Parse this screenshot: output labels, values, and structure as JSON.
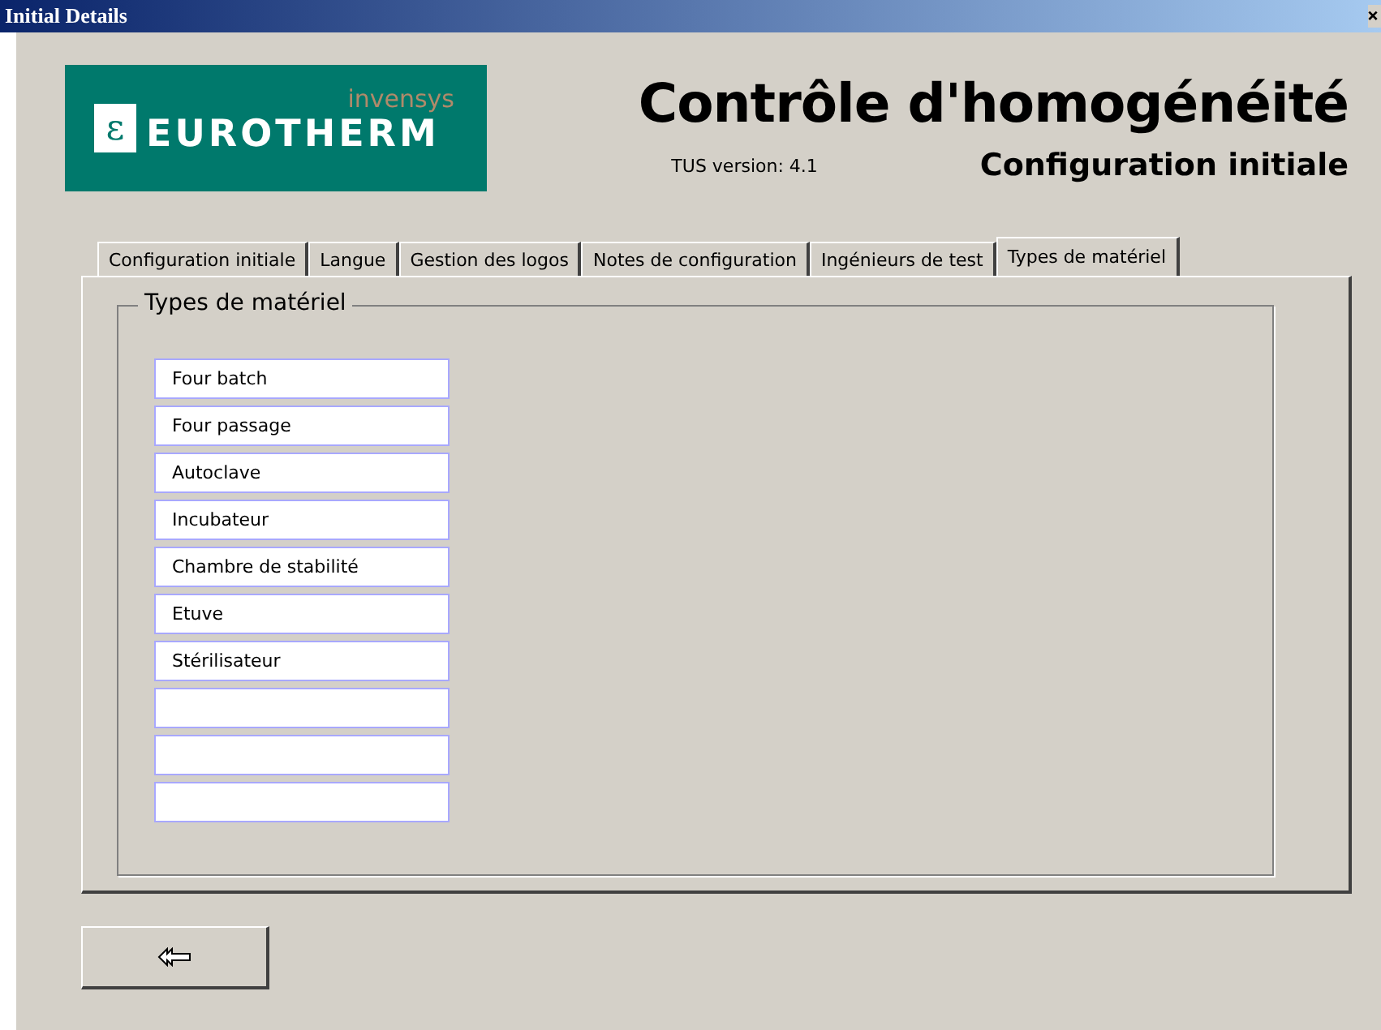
{
  "window": {
    "title": "Initial Details"
  },
  "logo": {
    "mark": "ε",
    "brand": "invensys",
    "name": "EUROTHERM"
  },
  "header": {
    "title": "Contrôle d'homogénéité",
    "version": "TUS version: 4.1",
    "subtitle": "Configuration initiale"
  },
  "tabs": [
    {
      "label": "Configuration initiale",
      "selected": false
    },
    {
      "label": "Langue",
      "selected": false
    },
    {
      "label": "Gestion des logos",
      "selected": false
    },
    {
      "label": "Notes de configuration",
      "selected": false
    },
    {
      "label": "Ingénieurs de test",
      "selected": false
    },
    {
      "label": "Types de matériel",
      "selected": true
    }
  ],
  "group": {
    "title": "Types de matériel",
    "fields": [
      {
        "kind": "filled",
        "value": "Four batch"
      },
      {
        "kind": "filled",
        "value": "Four passage"
      },
      {
        "kind": "filled",
        "value": "Autoclave"
      },
      {
        "kind": "filled",
        "value": "Incubateur"
      },
      {
        "kind": "filled",
        "value": "Chambre de stabilité"
      },
      {
        "kind": "filled",
        "value": "Etuve"
      },
      {
        "kind": "filled",
        "value": "Stérilisateur"
      },
      {
        "kind": "blank"
      },
      {
        "kind": "blank"
      },
      {
        "kind": "blank"
      }
    ]
  }
}
